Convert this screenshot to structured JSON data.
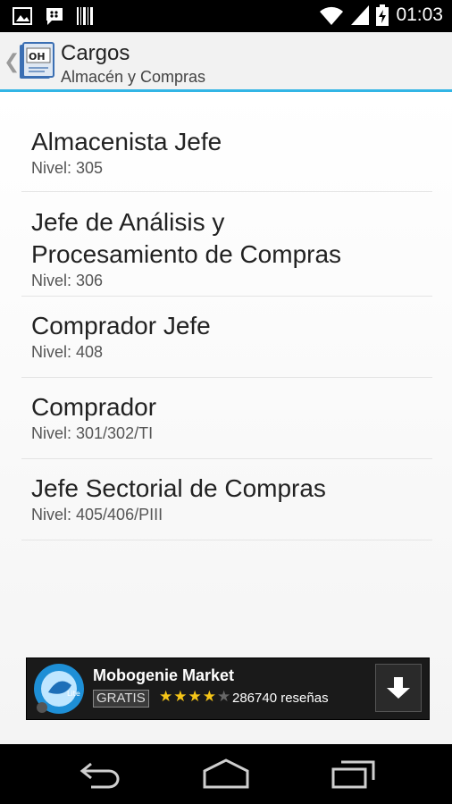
{
  "status_bar": {
    "time": "01:03",
    "icons": [
      "image-icon",
      "bbm-icon",
      "barcode-icon",
      "wifi-icon",
      "signal-icon",
      "battery-charging-icon"
    ]
  },
  "action_bar": {
    "title": "Cargos",
    "subtitle": "Almacén y Compras",
    "icon": "book-app-icon",
    "accent_color": "#33b5e5"
  },
  "list": {
    "items": [
      {
        "title": "Almacenista Jefe",
        "sub": "Nivel: 305"
      },
      {
        "title": "Jefe de Análisis y Procesamiento de Compras",
        "sub": "Nivel: 306"
      },
      {
        "title": "Comprador Jefe",
        "sub": "Nivel: 408"
      },
      {
        "title": "Comprador",
        "sub": "Nivel: 301/302/TI"
      },
      {
        "title": "Jefe Sectorial de Compras",
        "sub": "Nivel: 405/406/PIII"
      }
    ]
  },
  "ad": {
    "name": "Mobogenie Market",
    "badge": "GRATIS",
    "stars": "★★★★",
    "stars_off": "★",
    "rating": 4,
    "reviews": "286740 reseñas",
    "icon": "mobogenie-icon",
    "action_icon": "download-icon"
  },
  "nav_bar": {
    "buttons": [
      "back-icon",
      "home-icon",
      "recents-icon"
    ]
  }
}
